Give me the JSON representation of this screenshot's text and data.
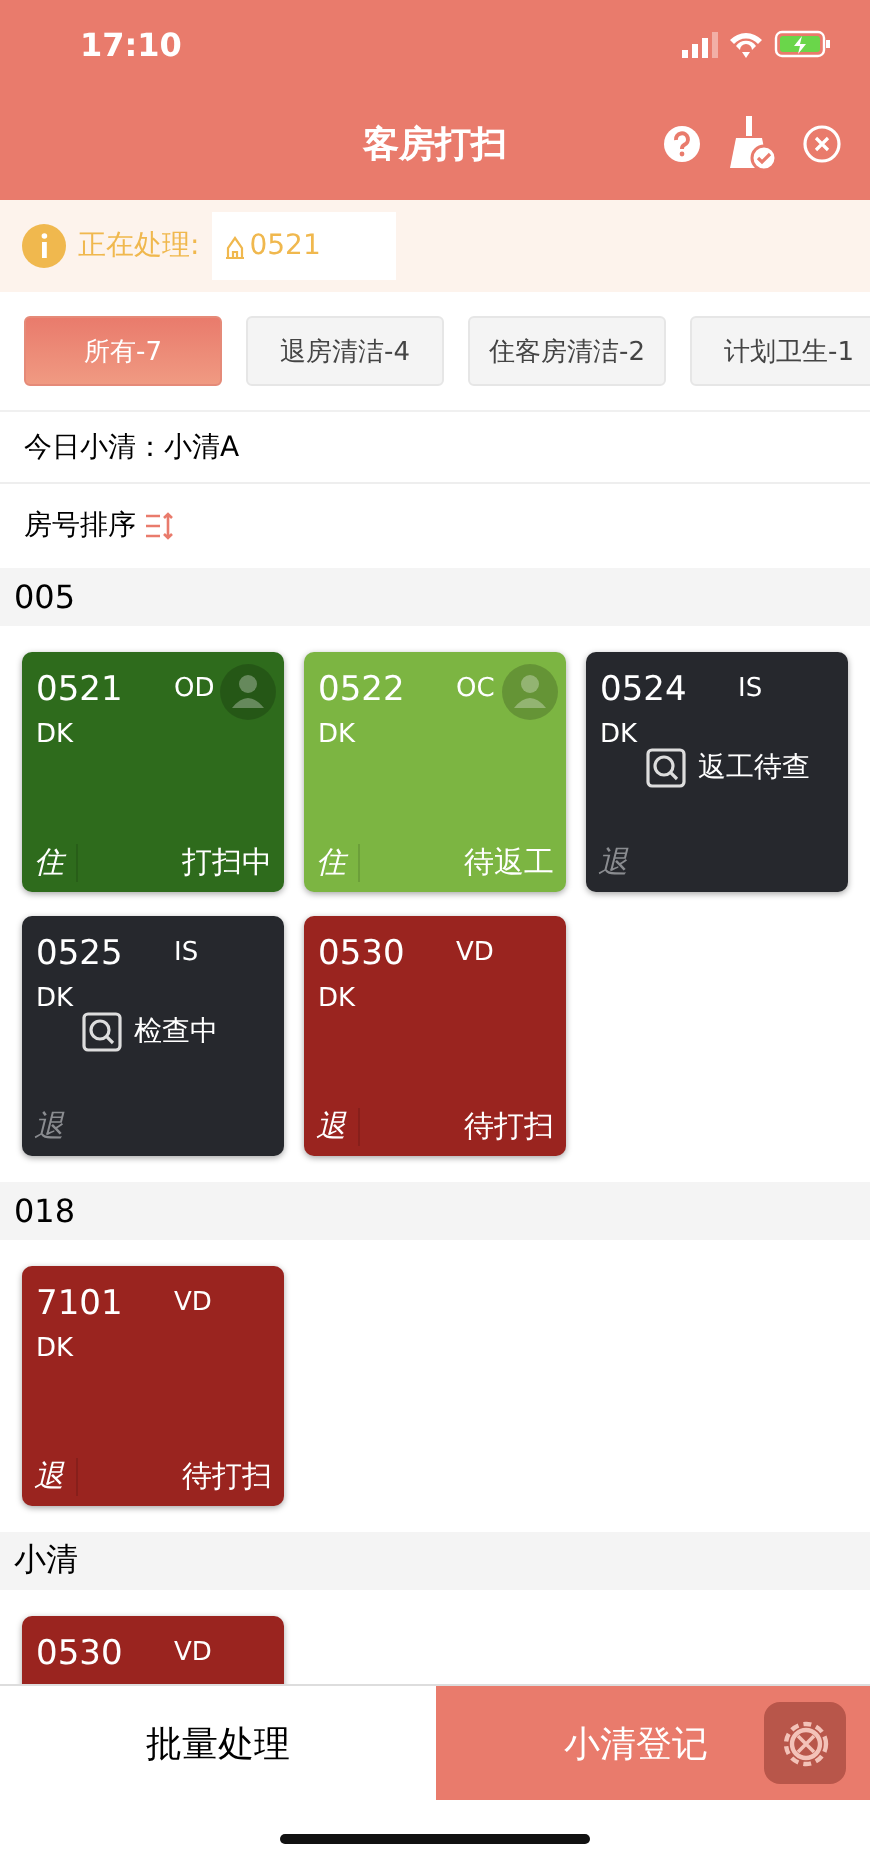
{
  "status_bar": {
    "time": "17:10"
  },
  "header": {
    "title": "客房打扫"
  },
  "processing": {
    "label": "正在处理:",
    "value": "0521"
  },
  "tabs": [
    {
      "label": "所有-7",
      "selected": true
    },
    {
      "label": "退房清洁-4",
      "selected": false
    },
    {
      "label": "住客房清洁-2",
      "selected": false
    },
    {
      "label": "计划卫生-1",
      "selected": false
    }
  ],
  "today_cleaner": "今日小清：小清A",
  "sort": {
    "label": "房号排序"
  },
  "groups": [
    {
      "name": "005",
      "rooms": [
        {
          "number": "0521",
          "status": "OD",
          "type": "DK",
          "occupancy": "住",
          "state": "打扫中",
          "color": "#2e6b1c",
          "occupied": true
        },
        {
          "number": "0522",
          "status": "OC",
          "type": "DK",
          "occupancy": "住",
          "state": "待返工",
          "color": "#7cb542",
          "occupied": true
        },
        {
          "number": "0524",
          "status": "IS",
          "type": "DK",
          "occupancy": "退",
          "inspect": "返工待查",
          "color": "#26282d",
          "occupied": false
        },
        {
          "number": "0525",
          "status": "IS",
          "type": "DK",
          "occupancy": "退",
          "inspect": "检查中",
          "color": "#26282d",
          "occupied": false
        },
        {
          "number": "0530",
          "status": "VD",
          "type": "DK",
          "occupancy": "退",
          "state": "待打扫",
          "color": "#9a241f",
          "occupied": false
        }
      ]
    },
    {
      "name": "018",
      "rooms": [
        {
          "number": "7101",
          "status": "VD",
          "type": "DK",
          "occupancy": "退",
          "state": "待打扫",
          "color": "#9a241f",
          "occupied": false
        }
      ]
    },
    {
      "name": "小清",
      "rooms": [
        {
          "number": "0530",
          "status": "VD",
          "color": "#9a241f",
          "occupied": false
        }
      ]
    }
  ],
  "bottom": {
    "batch": "批量处理",
    "register": "小清登记"
  }
}
